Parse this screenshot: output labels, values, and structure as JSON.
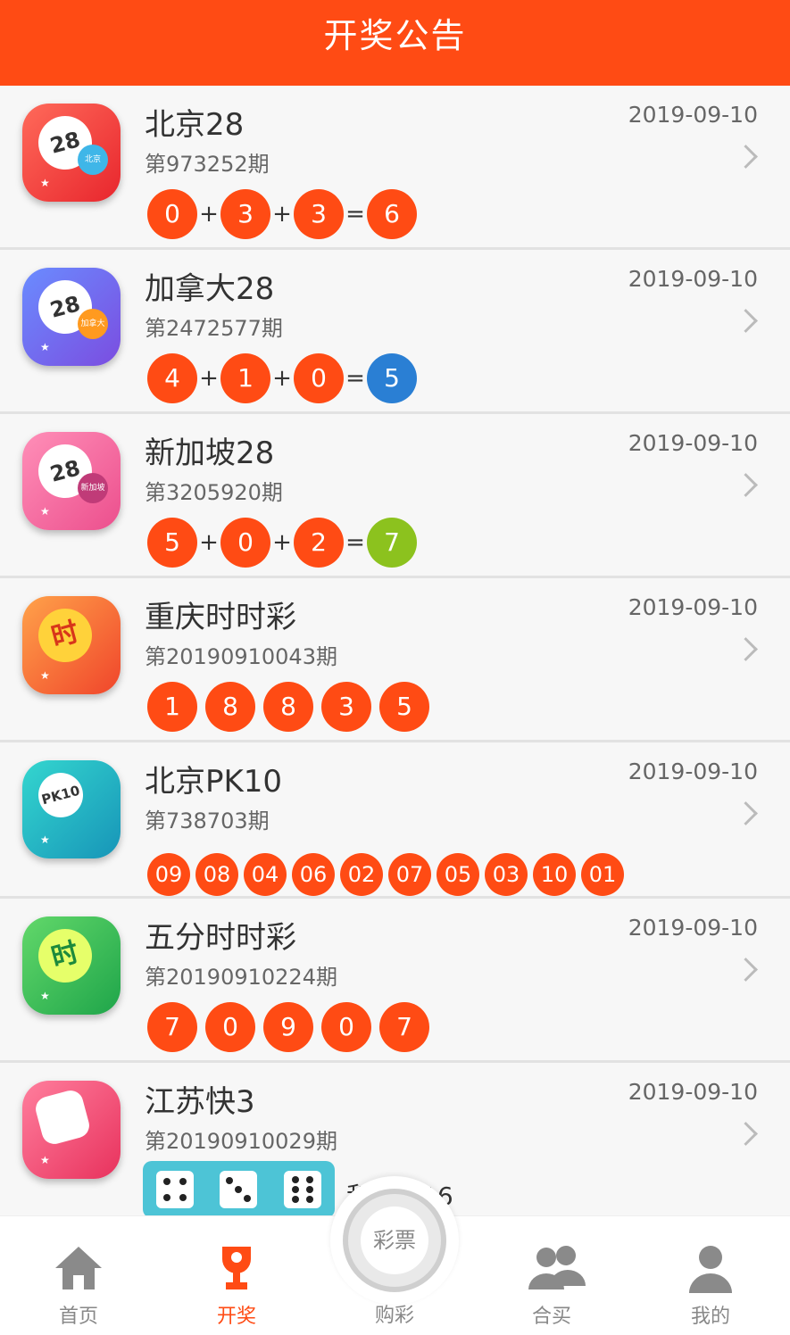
{
  "header": {
    "title": "开奖公告"
  },
  "colors": {
    "accent": "#ff4b14",
    "blue": "#2a7fd4",
    "green": "#8cc21e"
  },
  "lotteries": [
    {
      "name": "北京28",
      "issue": "第973252期",
      "date": "2019-09-10",
      "icon_text": "28",
      "icon_badge": "北京",
      "numbers": [
        "0",
        "3",
        "3"
      ],
      "result": "6",
      "result_color": "#ff4b14"
    },
    {
      "name": "加拿大28",
      "issue": "第2472577期",
      "date": "2019-09-10",
      "icon_text": "28",
      "icon_badge": "加拿大",
      "numbers": [
        "4",
        "1",
        "0"
      ],
      "result": "5",
      "result_color": "#2a7fd4"
    },
    {
      "name": "新加坡28",
      "issue": "第3205920期",
      "date": "2019-09-10",
      "icon_text": "28",
      "icon_badge": "新加坡",
      "numbers": [
        "5",
        "0",
        "2"
      ],
      "result": "7",
      "result_color": "#8cc21e"
    },
    {
      "name": "重庆时时彩",
      "issue": "第20190910043期",
      "date": "2019-09-10",
      "icon_text": "时",
      "numbers": [
        "1",
        "8",
        "8",
        "3",
        "5"
      ]
    },
    {
      "name": "北京PK10",
      "issue": "第738703期",
      "date": "2019-09-10",
      "icon_text": "PK10",
      "numbers": [
        "09",
        "08",
        "04",
        "06",
        "02",
        "07",
        "05",
        "03",
        "10",
        "01"
      ]
    },
    {
      "name": "五分时时彩",
      "issue": "第20190910224期",
      "date": "2019-09-10",
      "icon_text": "时",
      "numbers": [
        "7",
        "0",
        "9",
        "0",
        "7"
      ]
    },
    {
      "name": "江苏快3",
      "issue": "第20190910029期",
      "date": "2019-09-10",
      "dice": [
        4,
        3,
        6
      ],
      "sum_text": "和值：16"
    }
  ],
  "ops": {
    "plus": "+",
    "equals": "="
  },
  "tabbar": {
    "home": "首页",
    "draw": "开奖",
    "center_inner": "彩票",
    "buy": "购彩",
    "group": "合买",
    "mine": "我的"
  }
}
